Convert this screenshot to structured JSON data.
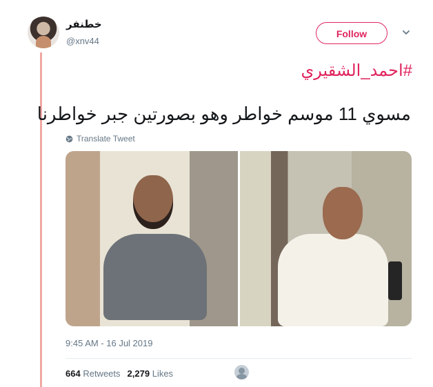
{
  "tweet": {
    "display_name": "خطنفر",
    "handle": "@xnv44",
    "follow_label": "Follow",
    "hashtag": "#احمد_الشقيري",
    "text": "مسوي 11 موسم خواطر وهو بصورتين جبر خواطرنا",
    "translate_label": "Translate Tweet",
    "timestamp": "9:45 AM - 16 Jul 2019",
    "retweets_count": "664",
    "retweets_label": "Retweets",
    "likes_count": "2,279",
    "likes_label": "Likes"
  },
  "icons": {
    "more_options": "chevron-down-icon",
    "translate": "globe-icon",
    "avatar": "user-avatar"
  },
  "colors": {
    "accent": "#e0245e",
    "thread_line": "#f2a7a3",
    "muted_text": "#657786"
  }
}
